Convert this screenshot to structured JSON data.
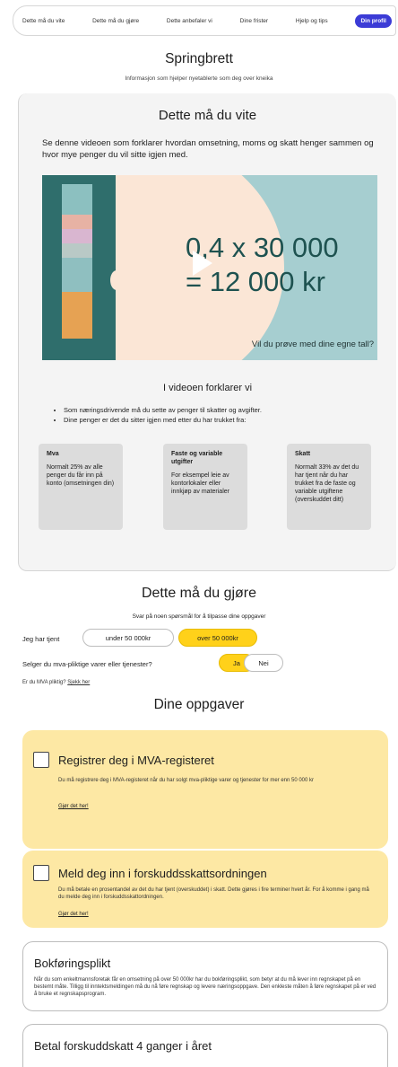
{
  "nav": {
    "items": [
      "Dette må du vite",
      "Dette må du gjøre",
      "Dette anbefaler vi",
      "Dine frister",
      "Hjelp og tips",
      "Din profil"
    ]
  },
  "page": {
    "title": "Springbrett",
    "subtitle": "Informasjon som hjelper nyetablerte som deg over kneika"
  },
  "know": {
    "title": "Dette må du vite",
    "intro": "Se denne videoen som forklarer hvordan omsetning, moms og skatt henger sammen og hvor mye penger du vil sitte igjen med.",
    "video": {
      "line1": "0,4 x 30 000",
      "line2": "= 12 000 kr",
      "cta": "Vil du prøve med dine egne tall?"
    },
    "explain_title": "I videoen forklarer vi",
    "bullets": [
      "Som næringsdrivende må du sette av penger til skatter og avgifter.",
      "Dine penger er det du sitter igjen med etter du har trukket fra:"
    ],
    "cards": [
      {
        "title": "Mva",
        "body": "Normalt 25% av alle penger du får inn på konto (omsetningen din)"
      },
      {
        "title": "Faste og variable utgifter",
        "body": "For eksempel leie av kontorlokaler eller innkjøp av materialer"
      },
      {
        "title": "Skatt",
        "body": "Normalt 33% av det du har tjent når du har trukket fra de faste og variable utgiftene (overskuddet ditt)"
      }
    ]
  },
  "do": {
    "title": "Dette må du gjøre",
    "subtitle": "Svar på noen spørsmål for å tilpasse dine oppgaver",
    "q1": {
      "label": "Jeg har tjent",
      "options": [
        "under 50 000kr",
        "over 50 000kr"
      ],
      "selected": 1
    },
    "q2": {
      "label": "Selger du mva-pliktige varer eller tjenester?",
      "options": [
        "Ja",
        "Nei"
      ],
      "selected": 0
    },
    "help_text": "Er du MVA pliktig?",
    "help_link": "Sjekk her"
  },
  "tasks": {
    "title": "Dine oppgaver",
    "items": [
      {
        "title": "Registrer deg i MVA-registeret",
        "desc": "Du må registrere deg i MVA-registeret når du har solgt mva-pliktige varer og tjenester for mer enn 50 000 kr",
        "link": "Gjør det her!"
      },
      {
        "title": "Meld deg inn i forskuddsskattsordningen",
        "desc": "Du må betale en prosentandel av det du har tjent (overskuddet) i skatt. Dette gjøres i fire terminer hvert år. For å komme i gang må du melde deg inn i forskuddsskattordningen.",
        "link": "Gjør det her!"
      },
      {
        "title": "Bokføringsplikt",
        "desc": "Når du som enkeltmannsforetak får en omsetning på over 50 000kr har du bokføringsplikt, som betyr at du må lever inn regnskapet på en bestemt måte. Tilligg til inntektsmeldingen må du nå føre regnskap og levere næringsoppgave. Den enkleste måten å føre regnskapet på er ved å bruke et regnskapsprogram.",
        "link": ""
      },
      {
        "title": "Betal forskuddskatt 4 ganger i året",
        "desc": "",
        "link": ""
      }
    ]
  },
  "colors": {
    "accent": "#3b3bd6",
    "selected": "#ffd11a",
    "task_bg": "#fde8a4",
    "video_bg": "#a6ced0",
    "video_dark": "#2f6e6c"
  }
}
